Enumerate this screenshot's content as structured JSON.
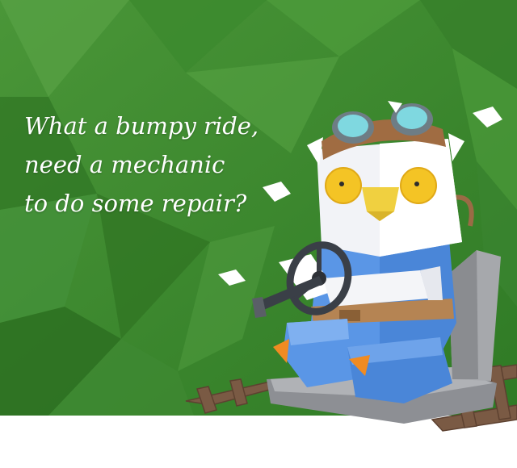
{
  "scene": {
    "caption_lines": [
      "What a bumpy ride,",
      "need a mechanic",
      "to do some repair?"
    ],
    "colors": {
      "background_green": "#3f8a30",
      "background_green_dark": "#2e7222",
      "bottom_strip": "#ffffff",
      "owl_body": "#ffffff",
      "overalls": "#4a86d8",
      "goggles_lens": "#7fd8e0",
      "eyes": "#f4c425",
      "beak": "#f0d040",
      "seat": "#9c9ea3",
      "rails": "#7a5a44"
    },
    "icons": [
      "owl-mechanic-character",
      "steering-wheel-icon",
      "feather-icon"
    ]
  }
}
